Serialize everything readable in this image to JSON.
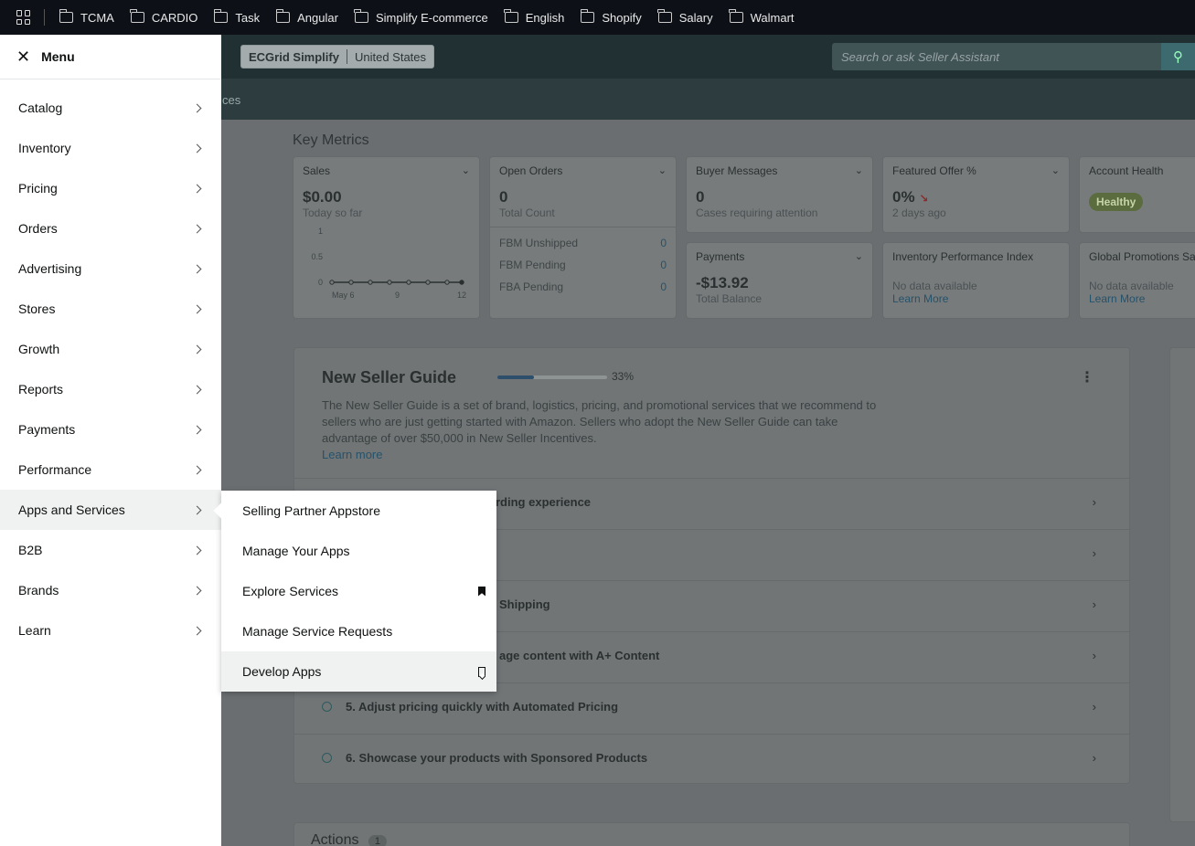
{
  "bookmarks": [
    "TCMA",
    "CARDIO",
    "Task",
    "Angular",
    "Simplify E-commerce",
    "English",
    "Shopify",
    "Salary",
    "Walmart"
  ],
  "header": {
    "store_name": "ECGrid Simplify",
    "region": "United States",
    "search_placeholder": "Search or ask Seller Assistant",
    "subnav_fragment": "ces"
  },
  "metrics": {
    "title": "Key Metrics",
    "sales": {
      "label": "Sales",
      "value": "$0.00",
      "sub": "Today so far",
      "chart_y": [
        "1",
        "0.5",
        "0"
      ],
      "chart_x": [
        "May 6",
        "9",
        "12"
      ]
    },
    "open_orders": {
      "label": "Open Orders",
      "value": "0",
      "sub": "Total Count",
      "rows": [
        {
          "label": "FBM Unshipped",
          "value": "0"
        },
        {
          "label": "FBM Pending",
          "value": "0"
        },
        {
          "label": "FBA Pending",
          "value": "0"
        }
      ]
    },
    "buyer_messages": {
      "label": "Buyer Messages",
      "value": "0",
      "sub": "Cases requiring attention"
    },
    "featured_offer": {
      "label": "Featured Offer %",
      "value": "0%",
      "sub": "2 days ago"
    },
    "account_health": {
      "label": "Account Health",
      "badge": "Healthy"
    },
    "payments": {
      "label": "Payments",
      "value": "-$13.92",
      "sub": "Total Balance"
    },
    "ipi": {
      "label": "Inventory Performance Index",
      "sub": "No data available",
      "link": "Learn More"
    },
    "global_promotions": {
      "label": "Global Promotions Sa",
      "sub": "No data available",
      "link": "Learn More"
    }
  },
  "guide": {
    "title": "New Seller Guide",
    "progress": 0.33,
    "progress_label": "33%",
    "description": "The New Seller Guide is a set of brand, logistics, pricing, and promotional services that we recommend to sellers who are just getting started with Amazon. Sellers who adopt the New Seller Guide can take advantage of over $50,000 in New Seller Incentives.",
    "learn_more": "Learn more",
    "steps": [
      "rding experience",
      "",
      "Shipping",
      "age content with A+ Content",
      "5. Adjust pricing quickly with Automated Pricing",
      "6. Showcase your products with Sponsored Products"
    ]
  },
  "actions": {
    "title": "Actions",
    "count": "1"
  },
  "menu": {
    "title": "Menu",
    "items": [
      "Catalog",
      "Inventory",
      "Pricing",
      "Orders",
      "Advertising",
      "Stores",
      "Growth",
      "Reports",
      "Payments",
      "Performance",
      "Apps and Services",
      "B2B",
      "Brands",
      "Learn"
    ],
    "active_item": "Apps and Services"
  },
  "submenu": {
    "items": [
      {
        "label": "Selling Partner Appstore",
        "bookmark": "none"
      },
      {
        "label": "Manage Your Apps",
        "bookmark": "none"
      },
      {
        "label": "Explore Services",
        "bookmark": "filled"
      },
      {
        "label": "Manage Service Requests",
        "bookmark": "none"
      },
      {
        "label": "Develop Apps",
        "bookmark": "outline"
      }
    ]
  }
}
